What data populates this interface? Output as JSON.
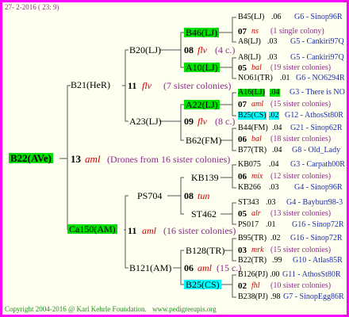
{
  "header": {
    "date": "27-  2-2016 ( 23:  9)"
  },
  "footer": {
    "copyright": "Copyright 2004-2016 @ Karl Kehrle Foundation.",
    "url": "www.pedigreeapis.org"
  },
  "root": {
    "code": "B22(AVe)",
    "year": "13",
    "name": "aml",
    "note": "(Drones from 16 sister colonies)"
  },
  "gen1": [
    {
      "code": "B21(HeR)",
      "year": "11",
      "name": "flv",
      "note": "(7 sister colonies)"
    },
    {
      "code": "Ca150(AM)",
      "year": "11",
      "name": "aml",
      "note": "(16 sister colonies)"
    }
  ],
  "gen2": [
    {
      "code": "B20(LJ)",
      "year": "08",
      "name": "flv",
      "note": "(4 c.)"
    },
    {
      "code": "A23(LJ)",
      "year": "09",
      "name": "flv",
      "note": "(8 c.)"
    },
    {
      "code": "PS704",
      "year": "08",
      "name": "tun",
      "note": ""
    },
    {
      "code": "B121(AM)",
      "year": "06",
      "name": "aml",
      "note": "(15 c.)"
    }
  ],
  "gen3": [
    {
      "code": "B46(LJ)"
    },
    {
      "code": "A10(LJ)"
    },
    {
      "code": "A22(LJ)"
    },
    {
      "code": "B62(FM)"
    },
    {
      "code": "KB139"
    },
    {
      "code": "ST462"
    },
    {
      "code": "B128(TR)"
    },
    {
      "code": "B25(CS)"
    }
  ],
  "gen4": [
    {
      "a": {
        "code": "B45(LJ)",
        "year": ".06",
        "loc": "G6 - Sinop96R"
      },
      "mid": {
        "year": "07",
        "name": "ns",
        "note": "(1 single colony)"
      },
      "b": {
        "code": "A8(LJ)",
        "year": ".03",
        "loc": "G5 - Cankiri97Q"
      }
    },
    {
      "a": {
        "code": "A8(LJ)",
        "year": ".03",
        "loc": "G5 - Cankiri97Q"
      },
      "mid": {
        "year": "05",
        "name": "bal",
        "note": "(19 sister colonies)"
      },
      "b": {
        "code": "NO61(TR)",
        "year": ".01",
        "loc": "G6 - NO6294R"
      }
    },
    {
      "a": {
        "code": "A16(LJ)",
        "year": ".04",
        "loc": "G3 - There is NO"
      },
      "mid": {
        "year": "07",
        "name": "aml",
        "note": "(15 sister colonies)"
      },
      "b": {
        "code": "B25(CS)",
        "year": ".02",
        "loc": "G12 - AthosSt80R"
      }
    },
    {
      "a": {
        "code": "B44(FM)",
        "year": ".04",
        "loc": "G21 - Sinop62R"
      },
      "mid": {
        "year": "06",
        "name": "bal",
        "note": "(18 sister colonies)"
      },
      "b": {
        "code": "B77(TR)",
        "year": ".04",
        "loc": "G8 - Old_Lady"
      }
    },
    {
      "a": {
        "code": "KB075",
        "year": ".04",
        "loc": "G3 - Carpath00R"
      },
      "mid": {
        "year": "06",
        "name": "mix",
        "note": "(12 sister colonies)"
      },
      "b": {
        "code": "KB266",
        "year": ".03",
        "loc": "G4 - Sinop96R"
      }
    },
    {
      "a": {
        "code": "ST343",
        "year": ".03",
        "loc": "G4 - Bayburt98-3"
      },
      "mid": {
        "year": "05",
        "name": "alr",
        "note": "(13 sister colonies)"
      },
      "b": {
        "code": "PS017",
        "year": ".01",
        "loc": "G16 - Sinop72R"
      }
    },
    {
      "a": {
        "code": "B95(TR)",
        "year": ".02",
        "loc": "G16 - Sinop72R"
      },
      "mid": {
        "year": "03",
        "name": "mrk",
        "note": "(15 sister colonies)"
      },
      "b": {
        "code": "B22(TR)",
        "year": ".99",
        "loc": "G10 - Atlas85R"
      }
    },
    {
      "a": {
        "code": "B126(PJ)",
        "year": ".00",
        "loc": "G11 - AthosSt80R"
      },
      "mid": {
        "year": "02",
        "name": "fhl",
        "note": "(10 sister colonies)"
      },
      "b": {
        "code": "B238(PJ)",
        "year": ".98",
        "loc": "G7 - SinopEgg86R"
      }
    }
  ]
}
